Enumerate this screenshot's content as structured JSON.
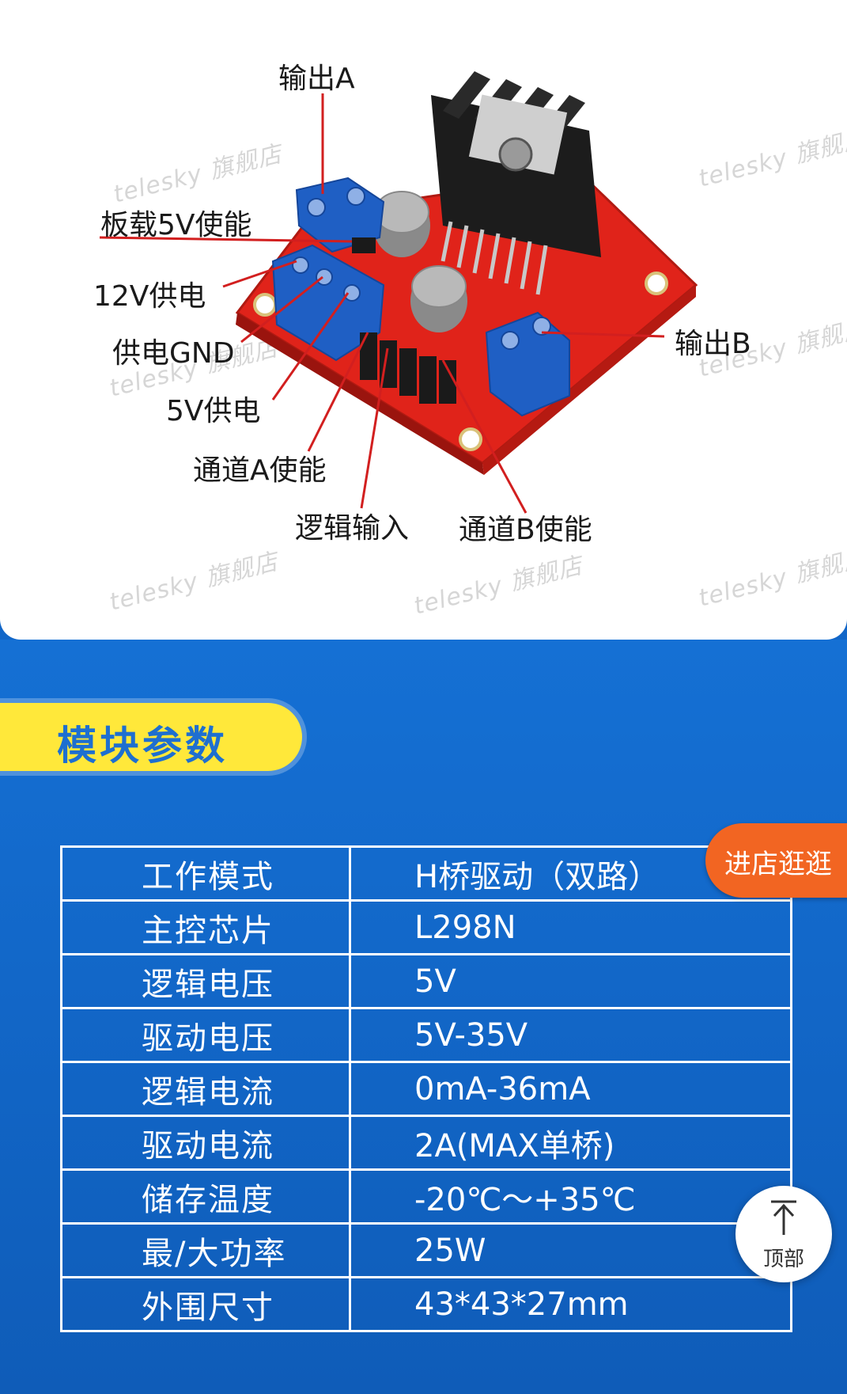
{
  "callouts": {
    "output_a": "输出A",
    "onboard_5v_enable": "板载5V使能",
    "power_12v": "12V供电",
    "power_gnd": "供电GND",
    "power_5v": "5V供电",
    "channel_a_enable": "通道A使能",
    "logic_input": "逻辑输入",
    "channel_b_enable": "通道B使能",
    "output_b": "输出B"
  },
  "watermark": "telesky 旗舰店",
  "section_heading": "模块参数",
  "specs": [
    {
      "key": "工作模式",
      "value": "H桥驱动（双路）"
    },
    {
      "key": "主控芯片",
      "value": "L298N"
    },
    {
      "key": "逻辑电压",
      "value": "5V"
    },
    {
      "key": "驱动电压",
      "value": "5V-35V"
    },
    {
      "key": "逻辑电流",
      "value": "0mA-36mA"
    },
    {
      "key": "驱动电流",
      "value": "2A(MAX单桥)"
    },
    {
      "key": "储存温度",
      "value": "-20℃～+35℃"
    },
    {
      "key": "最/大功率",
      "value": "25W"
    },
    {
      "key": "外围尺寸",
      "value": "43*43*27mm"
    }
  ],
  "shop_button_label": "进店逛逛",
  "top_button_label": "顶部",
  "icons": {
    "top": "arrow-up-icon"
  },
  "colors": {
    "board_red": "#e0231a",
    "terminal_blue": "#1f5fc4",
    "heatsink": "#1c1c1c",
    "blue_bg": "#1166c8",
    "heading_yellow": "#ffe83a",
    "shop_orange": "#f26522"
  }
}
